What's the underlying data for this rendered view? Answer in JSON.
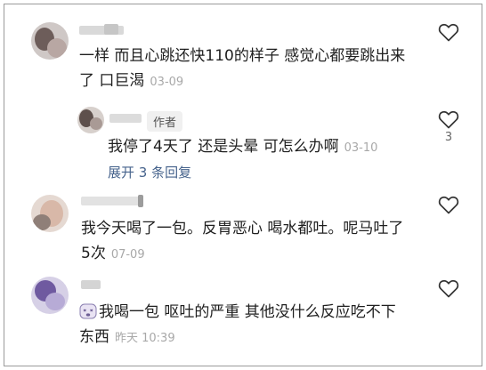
{
  "comments": [
    {
      "text_line1": "一样 而且心跳还快110的样子 感觉心都要跳出来",
      "text_line2": "了 口巨渴",
      "time": "03-09",
      "like_icon": "heart-outline-icon"
    },
    {
      "author_badge": "作者",
      "text": "我停了4天了 还是头晕 可怎么办啊",
      "time": "03-10",
      "like_count": "3",
      "like_icon": "heart-outline-icon"
    },
    {
      "expand_label": "展开 3 条回复"
    },
    {
      "text_line1": "我今天喝了一包。反胃恶心 喝水都吐。呢马吐了",
      "text_line2": "5次",
      "time": "07-09",
      "like_icon": "heart-outline-icon"
    },
    {
      "emoji_icon": "dizzy-face-emoji-icon",
      "text_line1": "我喝一包 呕吐的严重 其他没什么反应吃不下",
      "text_line2": "东西",
      "time": "昨天 10:39",
      "like_icon": "heart-outline-icon"
    }
  ]
}
